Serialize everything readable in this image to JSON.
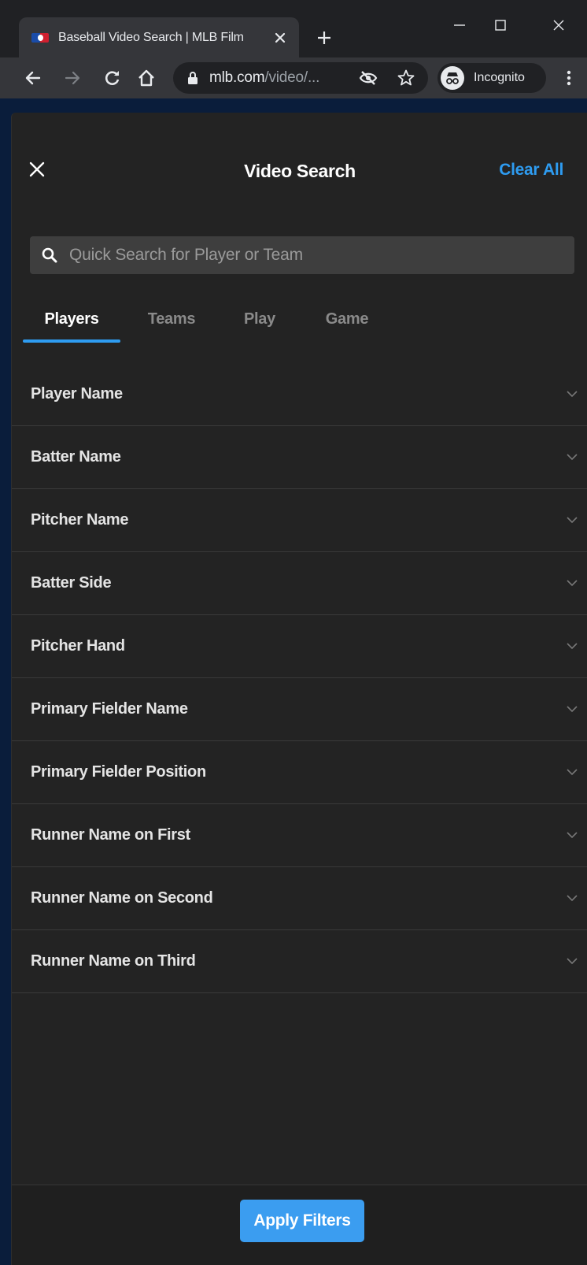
{
  "browser": {
    "tab": {
      "title": "Baseball Video Search | MLB Film"
    },
    "address": {
      "host": "mlb.com",
      "path": "/video/..."
    },
    "profile": {
      "label": "Incognito"
    }
  },
  "panel": {
    "title": "Video Search",
    "clear_all_label": "Clear All",
    "search": {
      "placeholder": "Quick Search for Player or Team",
      "value": ""
    },
    "tabs": [
      {
        "label": "Players",
        "active": true
      },
      {
        "label": "Teams",
        "active": false
      },
      {
        "label": "Play",
        "active": false
      },
      {
        "label": "Game",
        "active": false
      }
    ],
    "filters": [
      {
        "label": "Player Name"
      },
      {
        "label": "Batter Name"
      },
      {
        "label": "Pitcher Name"
      },
      {
        "label": "Batter Side"
      },
      {
        "label": "Pitcher Hand"
      },
      {
        "label": "Primary Fielder Name"
      },
      {
        "label": "Primary Fielder Position"
      },
      {
        "label": "Runner Name on First"
      },
      {
        "label": "Runner Name on Second"
      },
      {
        "label": "Runner Name on Third"
      }
    ],
    "apply_label": "Apply Filters"
  },
  "colors": {
    "accent": "#2e9cf1",
    "panel_bg": "#232323",
    "page_bg": "#0a1d3b"
  },
  "icons": [
    "mlb-favicon-icon",
    "tab-close-icon",
    "plus-icon",
    "minimize-icon",
    "maximize-icon",
    "window-close-icon",
    "back-arrow-icon",
    "forward-arrow-icon",
    "reload-icon",
    "home-icon",
    "lock-icon",
    "eye-slash-icon",
    "star-icon",
    "incognito-icon",
    "kebab-menu-icon",
    "close-icon",
    "search-icon",
    "chevron-down-icon"
  ]
}
